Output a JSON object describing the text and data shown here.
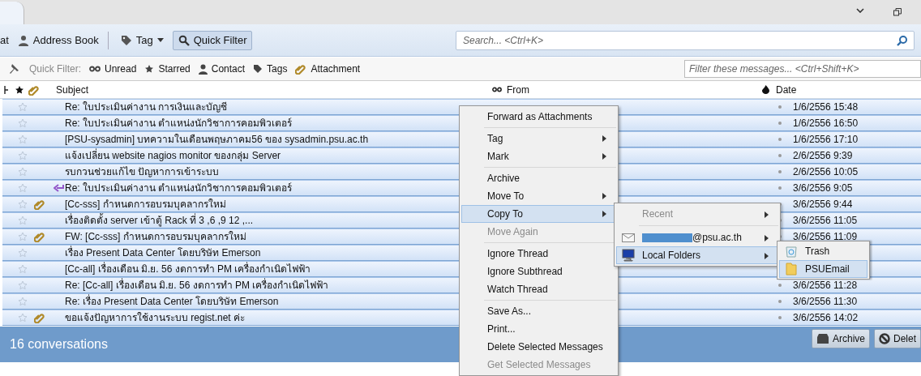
{
  "toolbar": {
    "items": [
      {
        "kind": "button",
        "label": "at",
        "selected": false
      },
      {
        "kind": "button",
        "label": "Address Book",
        "selected": false
      },
      {
        "kind": "menu",
        "label": "Tag",
        "selected": false
      },
      {
        "kind": "button",
        "label": "Quick Filter",
        "selected": true
      }
    ],
    "search": {
      "placeholder": "Search... <Ctrl+K>"
    }
  },
  "quick_filter": {
    "label": "Quick Filter:",
    "items": [
      "Unread",
      "Starred",
      "Contact",
      "Tags",
      "Attachment"
    ],
    "search": {
      "placeholder": "Filter these messages... <Ctrl+Shift+K>"
    }
  },
  "table": {
    "columns": [
      "Subject",
      "From",
      "Date"
    ],
    "rows": [
      {
        "subject": "Re: ใบประเมินค่างาน การเงินและบัญชี",
        "date": "1/6/2556 15:48",
        "attachment": false,
        "replied": false,
        "selected": true
      },
      {
        "subject": "Re: ใบประเมินค่างาน ตำแหน่งนักวิชาการคอมพิวเตอร์",
        "date": "1/6/2556 16:50",
        "attachment": false,
        "replied": false,
        "selected": true
      },
      {
        "subject": "[PSU-sysadmin] บทความในเดือนพฤษภาคม56 ของ sysadmin.psu.ac.th",
        "date": "1/6/2556 17:10",
        "attachment": false,
        "replied": false,
        "selected": true
      },
      {
        "subject": "แจ้งเปลี่ยน website nagios monitor ของกลุ่ม Server",
        "date": "2/6/2556 9:39",
        "attachment": false,
        "replied": false,
        "selected": true
      },
      {
        "subject": "รบกวนช่วยแก้ไข ปัญหาการเข้าระบบ",
        "date": "2/6/2556 10:05",
        "attachment": false,
        "replied": false,
        "selected": true
      },
      {
        "subject": "Re: ใบประเมินค่างาน ตำแหน่งนักวิชาการคอมพิวเตอร์",
        "date": "3/6/2556 9:05",
        "attachment": false,
        "replied": true,
        "selected": true
      },
      {
        "subject": "[Cc-sss] กำหนดการอบรมบุคลากรใหม่",
        "date": "3/6/2556 9:44",
        "attachment": true,
        "replied": false,
        "selected": true
      },
      {
        "subject": "เรื่องติดตั้ง server เข้าตู้ Rack ที่ 3 ,6 ,9 12 ,...",
        "date": "3/6/2556 11:05",
        "attachment": false,
        "replied": false,
        "selected": true
      },
      {
        "subject": "FW: [Cc-sss] กำหนดการอบรมบุคลากรใหม่",
        "date": "3/6/2556 11:09",
        "attachment": true,
        "replied": false,
        "selected": true
      },
      {
        "subject": "เรื่อง Present Data Center โดยบริษัท Emerson",
        "attachment": false,
        "replied": false,
        "selected": true
      },
      {
        "subject": "[Cc-all] เรื่องเดือน มิ.ย. 56 งดการทำ PM เครื่องกำเนิดไฟฟ้า",
        "attachment": false,
        "replied": false,
        "selected": true
      },
      {
        "subject": "Re: [Cc-all] เรื่องเดือน มิ.ย. 56 งดการทำ PM เครื่องกำเนิดไฟฟ้า",
        "date": "3/6/2556 11:28",
        "attachment": false,
        "replied": false,
        "selected": true
      },
      {
        "subject": "Re: เรื่อง Present Data Center โดยบริษัท Emerson",
        "date": "3/6/2556 11:30",
        "attachment": false,
        "replied": false,
        "selected": true
      },
      {
        "subject": "ขอแจ้งปัญหาการใช้งานระบบ regist.net ค่ะ",
        "date": "3/6/2556 14:02",
        "attachment": true,
        "replied": false,
        "selected": true
      }
    ]
  },
  "status_bar": {
    "text": "16 conversations",
    "buttons": [
      "Archive",
      "Delet"
    ]
  },
  "context_menu": {
    "items": [
      {
        "kind": "item",
        "label": "Forward as Attachments",
        "disabled": false,
        "submenu": false,
        "selected": false
      },
      {
        "kind": "separator"
      },
      {
        "kind": "item",
        "label": "Tag",
        "disabled": false,
        "submenu": true,
        "selected": false
      },
      {
        "kind": "item",
        "label": "Mark",
        "disabled": false,
        "submenu": true,
        "selected": false
      },
      {
        "kind": "separator"
      },
      {
        "kind": "item",
        "label": "Archive",
        "disabled": false,
        "submenu": false,
        "selected": false
      },
      {
        "kind": "item",
        "label": "Move To",
        "disabled": false,
        "submenu": true,
        "selected": false
      },
      {
        "kind": "item",
        "label": "Copy To",
        "disabled": false,
        "submenu": true,
        "selected": true
      },
      {
        "kind": "item",
        "label": "Move Again",
        "disabled": true,
        "submenu": false,
        "selected": false
      },
      {
        "kind": "separator"
      },
      {
        "kind": "item",
        "label": "Ignore Thread",
        "disabled": false,
        "submenu": false,
        "selected": false
      },
      {
        "kind": "item",
        "label": "Ignore Subthread",
        "disabled": false,
        "submenu": false,
        "selected": false
      },
      {
        "kind": "item",
        "label": "Watch Thread",
        "disabled": false,
        "submenu": false,
        "selected": false
      },
      {
        "kind": "separator"
      },
      {
        "kind": "item",
        "label": "Save As...",
        "disabled": false,
        "submenu": false,
        "selected": false
      },
      {
        "kind": "item",
        "label": "Print...",
        "disabled": false,
        "submenu": false,
        "selected": false
      },
      {
        "kind": "item",
        "label": "Delete Selected Messages",
        "disabled": false,
        "submenu": false,
        "selected": false
      },
      {
        "kind": "item",
        "label": "Get Selected Messages",
        "disabled": true,
        "submenu": false,
        "selected": false
      }
    ]
  },
  "copy_to_menu": {
    "items": [
      {
        "kind": "recent",
        "label": "Recent",
        "disabled": true,
        "selected": false
      },
      {
        "kind": "separator"
      },
      {
        "kind": "account",
        "label": "@psu.ac.th",
        "disabled": false,
        "selected": false
      },
      {
        "kind": "local",
        "label": "Local Folders",
        "disabled": false,
        "selected": true
      }
    ]
  },
  "local_folders_menu": {
    "items": [
      {
        "kind": "trash",
        "label": "Trash",
        "selected": false
      },
      {
        "kind": "folder",
        "label": "PSUEmail",
        "selected": true
      }
    ]
  }
}
